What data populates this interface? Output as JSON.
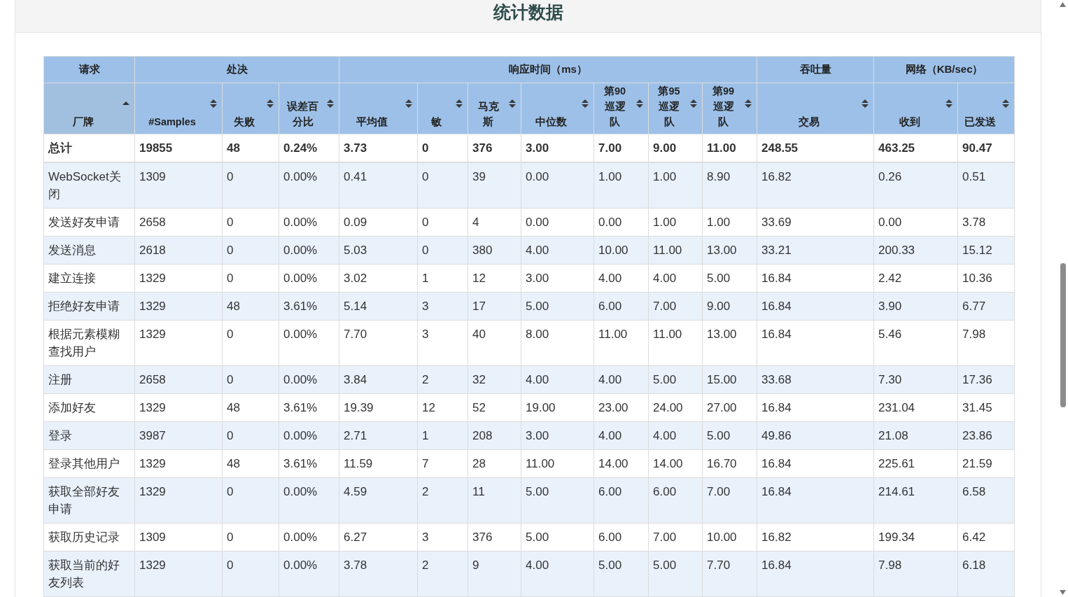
{
  "title": "统计数据",
  "table": {
    "groups": [
      {
        "label": "请求",
        "columns": [
          {
            "label": "厂牌",
            "sorted": true
          }
        ]
      },
      {
        "label": "处决",
        "columns": [
          {
            "label": "#Samples",
            "sorted": false
          },
          {
            "label": "失败",
            "sorted": false
          },
          {
            "label": "误差百分比",
            "sorted": false
          }
        ]
      },
      {
        "label": "响应时间（ms）",
        "columns": [
          {
            "label": "平均值",
            "sorted": false
          },
          {
            "label": "敏",
            "sorted": false
          },
          {
            "label": "马克斯",
            "sorted": false
          },
          {
            "label": "中位数",
            "sorted": false
          },
          {
            "label": "第90巡逻队",
            "sorted": false
          },
          {
            "label": "第95巡逻队",
            "sorted": false
          },
          {
            "label": "第99巡逻队",
            "sorted": false
          }
        ]
      },
      {
        "label": "吞吐量",
        "columns": [
          {
            "label": "交易",
            "sorted": false
          }
        ]
      },
      {
        "label": "网络（KB/sec）",
        "columns": [
          {
            "label": "收到",
            "sorted": false
          },
          {
            "label": "已发送",
            "sorted": false
          }
        ]
      }
    ],
    "total": [
      "总计",
      "19855",
      "48",
      "0.24%",
      "3.73",
      "0",
      "376",
      "3.00",
      "7.00",
      "9.00",
      "11.00",
      "248.55",
      "463.25",
      "90.47"
    ],
    "rows": [
      [
        "WebSocket关闭",
        "1309",
        "0",
        "0.00%",
        "0.41",
        "0",
        "39",
        "0.00",
        "1.00",
        "1.00",
        "8.90",
        "16.82",
        "0.26",
        "0.51"
      ],
      [
        "发送好友申请",
        "2658",
        "0",
        "0.00%",
        "0.09",
        "0",
        "4",
        "0.00",
        "0.00",
        "1.00",
        "1.00",
        "33.69",
        "0.00",
        "3.78"
      ],
      [
        "发送消息",
        "2618",
        "0",
        "0.00%",
        "5.03",
        "0",
        "380",
        "4.00",
        "10.00",
        "11.00",
        "13.00",
        "33.21",
        "200.33",
        "15.12"
      ],
      [
        "建立连接",
        "1329",
        "0",
        "0.00%",
        "3.02",
        "1",
        "12",
        "3.00",
        "4.00",
        "4.00",
        "5.00",
        "16.84",
        "2.42",
        "10.36"
      ],
      [
        "拒绝好友申请",
        "1329",
        "48",
        "3.61%",
        "5.14",
        "3",
        "17",
        "5.00",
        "6.00",
        "7.00",
        "9.00",
        "16.84",
        "3.90",
        "6.77"
      ],
      [
        "根据元素模糊查找用户",
        "1329",
        "0",
        "0.00%",
        "7.70",
        "3",
        "40",
        "8.00",
        "11.00",
        "11.00",
        "13.00",
        "16.84",
        "5.46",
        "7.98"
      ],
      [
        "注册",
        "2658",
        "0",
        "0.00%",
        "3.84",
        "2",
        "32",
        "4.00",
        "4.00",
        "5.00",
        "15.00",
        "33.68",
        "7.30",
        "17.36"
      ],
      [
        "添加好友",
        "1329",
        "48",
        "3.61%",
        "19.39",
        "12",
        "52",
        "19.00",
        "23.00",
        "24.00",
        "27.00",
        "16.84",
        "231.04",
        "31.45"
      ],
      [
        "登录",
        "3987",
        "0",
        "0.00%",
        "2.71",
        "1",
        "208",
        "3.00",
        "4.00",
        "4.00",
        "5.00",
        "49.86",
        "21.08",
        "23.86"
      ],
      [
        "登录其他用户",
        "1329",
        "48",
        "3.61%",
        "11.59",
        "7",
        "28",
        "11.00",
        "14.00",
        "14.00",
        "16.70",
        "16.84",
        "225.61",
        "21.59"
      ],
      [
        "获取全部好友申请",
        "1329",
        "0",
        "0.00%",
        "4.59",
        "2",
        "11",
        "5.00",
        "6.00",
        "6.00",
        "7.00",
        "16.84",
        "214.61",
        "6.58"
      ],
      [
        "获取历史记录",
        "1309",
        "0",
        "0.00%",
        "6.27",
        "3",
        "376",
        "5.00",
        "6.00",
        "7.00",
        "10.00",
        "16.82",
        "199.34",
        "6.42"
      ],
      [
        "获取当前的好友列表",
        "1329",
        "0",
        "0.00%",
        "3.78",
        "2",
        "9",
        "4.00",
        "5.00",
        "5.00",
        "7.70",
        "16.84",
        "7.98",
        "6.18"
      ]
    ]
  }
}
